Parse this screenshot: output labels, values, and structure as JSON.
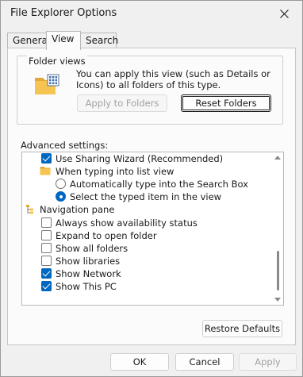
{
  "window": {
    "title": "File Explorer Options"
  },
  "tabs": [
    {
      "label": "General"
    },
    {
      "label": "View"
    },
    {
      "label": "Search"
    }
  ],
  "folder_views": {
    "label": "Folder views",
    "description": "You can apply this view (such as Details or Icons) to all folders of this type.",
    "apply_button": "Apply to Folders",
    "reset_button": "Reset Folders"
  },
  "advanced": {
    "label": "Advanced settings:",
    "items": [
      {
        "label": "Use Sharing Wizard (Recommended)",
        "type": "checkbox",
        "checked": true
      },
      {
        "label": "When typing into list view",
        "type": "folder"
      },
      {
        "label": "Automatically type into the Search Box",
        "type": "radio",
        "checked": false
      },
      {
        "label": "Select the typed item in the view",
        "type": "radio",
        "checked": true
      },
      {
        "label": "Navigation pane",
        "type": "nav"
      },
      {
        "label": "Always show availability status",
        "type": "checkbox",
        "checked": false
      },
      {
        "label": "Expand to open folder",
        "type": "checkbox",
        "checked": false
      },
      {
        "label": "Show all folders",
        "type": "checkbox",
        "checked": false
      },
      {
        "label": "Show libraries",
        "type": "checkbox",
        "checked": false
      },
      {
        "label": "Show Network",
        "type": "checkbox",
        "checked": true
      },
      {
        "label": "Show This PC",
        "type": "checkbox",
        "checked": true
      }
    ]
  },
  "restore_button": "Restore Defaults",
  "footer": {
    "ok": "OK",
    "cancel": "Cancel",
    "apply": "Apply"
  },
  "colors": {
    "accent": "#0067c0",
    "folder": "#f2c14e"
  }
}
